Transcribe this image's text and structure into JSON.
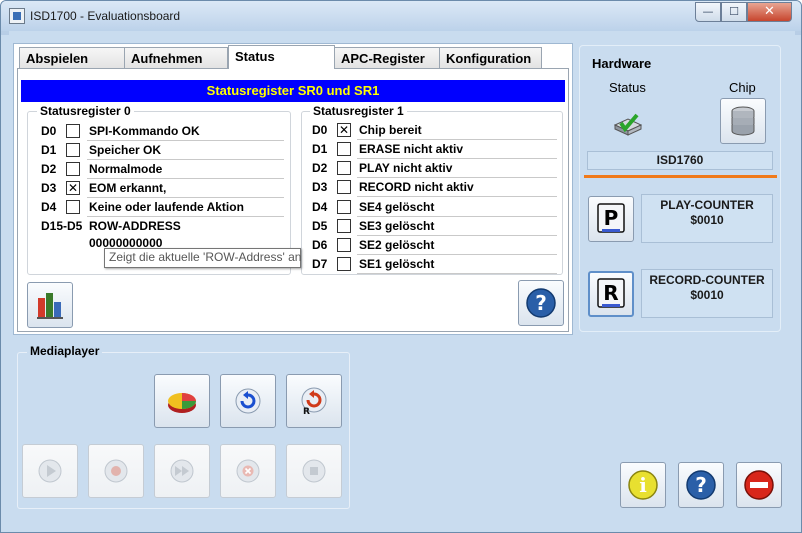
{
  "window": {
    "title": "ISD1700 - Evaluationsboard",
    "controls": {
      "minimize": "—",
      "maximize": "☐",
      "close": "✕"
    }
  },
  "tabs": [
    {
      "label": "Abspielen",
      "active": false
    },
    {
      "label": "Aufnehmen",
      "active": false
    },
    {
      "label": "Status",
      "active": true
    },
    {
      "label": "APC-Register",
      "active": false
    },
    {
      "label": "Konfiguration",
      "active": false
    }
  ],
  "status": {
    "header": "Statusregister SR0 und SR1",
    "sr0": {
      "title": "Statusregister 0",
      "rows": [
        {
          "bit": "D0",
          "text": "SPI-Kommando OK",
          "checked": false
        },
        {
          "bit": "D1",
          "text": "Speicher OK",
          "checked": false
        },
        {
          "bit": "D2",
          "text": "Normalmode",
          "checked": false
        },
        {
          "bit": "D3",
          "text": "EOM erkannt,",
          "checked": true
        },
        {
          "bit": "D4",
          "text": "Keine oder laufende Aktion",
          "checked": false
        }
      ],
      "row_address": {
        "bit": "D15-D5",
        "label": "ROW-ADDRESS",
        "value": "00000000000"
      }
    },
    "sr1": {
      "title": "Statusregister 1",
      "rows": [
        {
          "bit": "D0",
          "text": "Chip bereit",
          "checked": true
        },
        {
          "bit": "D1",
          "text": "ERASE nicht aktiv",
          "checked": false
        },
        {
          "bit": "D2",
          "text": "PLAY nicht aktiv",
          "checked": false
        },
        {
          "bit": "D3",
          "text": "RECORD nicht aktiv",
          "checked": false
        },
        {
          "bit": "D4",
          "text": "SE4 gelöscht",
          "checked": false
        },
        {
          "bit": "D5",
          "text": "SE3 gelöscht",
          "checked": false
        },
        {
          "bit": "D6",
          "text": "SE2 gelöscht",
          "checked": false
        },
        {
          "bit": "D7",
          "text": "SE1 gelöscht",
          "checked": false
        }
      ]
    },
    "tooltip": "Zeigt die aktuelle 'ROW-Address' an",
    "check_mark": "✕"
  },
  "mediaplayer": {
    "title": "Mediaplayer"
  },
  "hardware": {
    "title": "Hardware",
    "status_label": "Status",
    "chip_label": "Chip",
    "chip_name": "ISD1760",
    "play_counter_label": "PLAY-COUNTER",
    "play_counter_value": "$0010",
    "record_counter_label": "RECORD-COUNTER",
    "record_counter_value": "$0010",
    "play_letter": "P",
    "record_letter": "R"
  },
  "icon_letters": {
    "question": "?",
    "info": "i",
    "rewind_r": "R"
  },
  "colors": {
    "header_bg": "#0000ff",
    "header_text": "#ffff00",
    "accent_line": "#f07a1a",
    "window_bg": "#c9dcef"
  }
}
